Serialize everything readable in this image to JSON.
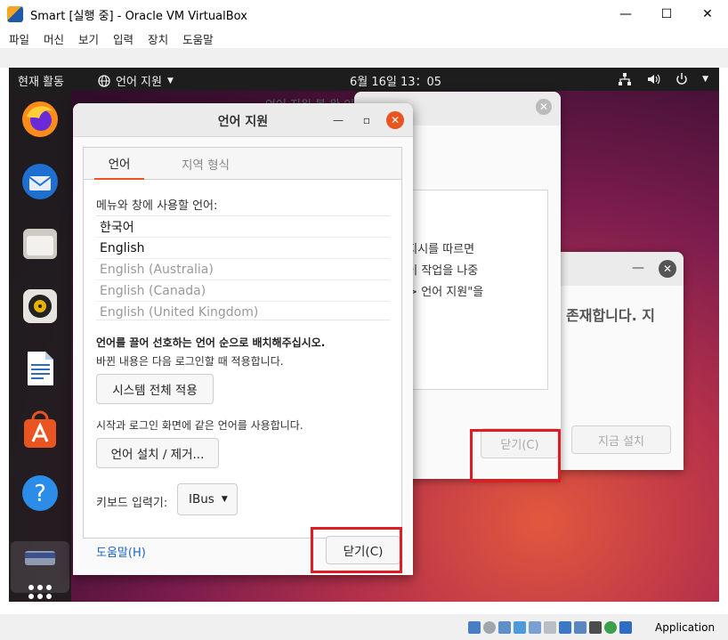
{
  "vbox": {
    "title": "Smart [실행 중] - Oracle VM VirtualBox",
    "menu": [
      "파일",
      "머신",
      "보기",
      "입력",
      "장치",
      "도움말"
    ],
    "controls": {
      "minimize": "—",
      "maximize": "☐",
      "close": "✕"
    },
    "status_host_key": "Application"
  },
  "topbar": {
    "activities": "현재 활동",
    "language_menu": "언어 지원",
    "clock": "6월 16일  13：05"
  },
  "dock": {
    "apps": [
      "firefox-icon",
      "thunderbird-icon",
      "files-icon",
      "rhythmbox-icon",
      "writer-icon",
      "software-icon",
      "help-icon",
      "terminal-icon",
      "show-apps-icon"
    ]
  },
  "background_dialog": {
    "title_partial": "언어 지원 불 완 인",
    "text_line1": "을 누른 후 지시를 따르면",
    "text_line2": "야 합니다. 이 작업을 나중",
    "text_line3": "템 설정... -> 언어 지원\"을",
    "close_button": "닫기(C)",
    "install_button": "지금 설치",
    "text_right": "존재합니다. 지"
  },
  "dialog": {
    "title": "언어 지원",
    "tabs": [
      "언어",
      "지역 형식"
    ],
    "caption": "메뉴와 창에 사용할 언어:",
    "languages": [
      {
        "name": "한국어",
        "enabled": true
      },
      {
        "name": "English",
        "enabled": true
      },
      {
        "name": "English (Australia)",
        "enabled": false
      },
      {
        "name": "English (Canada)",
        "enabled": false
      },
      {
        "name": "English (United Kingdom)",
        "enabled": false
      }
    ],
    "pref_bold": "언어를 끌어 선호하는 언어 순으로 배치해주십시오.",
    "pref_note": "바뀐 내용은 다음 로그인할 때 적용합니다.",
    "apply_system_button": "시스템 전체 적용",
    "login_note": "시작과 로그인 화면에 같은 언어를 사용합니다.",
    "install_remove_button": "언어 설치 / 제거...",
    "keyboard_label": "키보드 입력기:",
    "keyboard_value": "IBus",
    "help_link": "도움말(H)",
    "close_button": "닫기(C)"
  },
  "colors": {
    "accent": "#e95420",
    "highlight_box": "#e01b24",
    "link": "#1a64c8"
  }
}
